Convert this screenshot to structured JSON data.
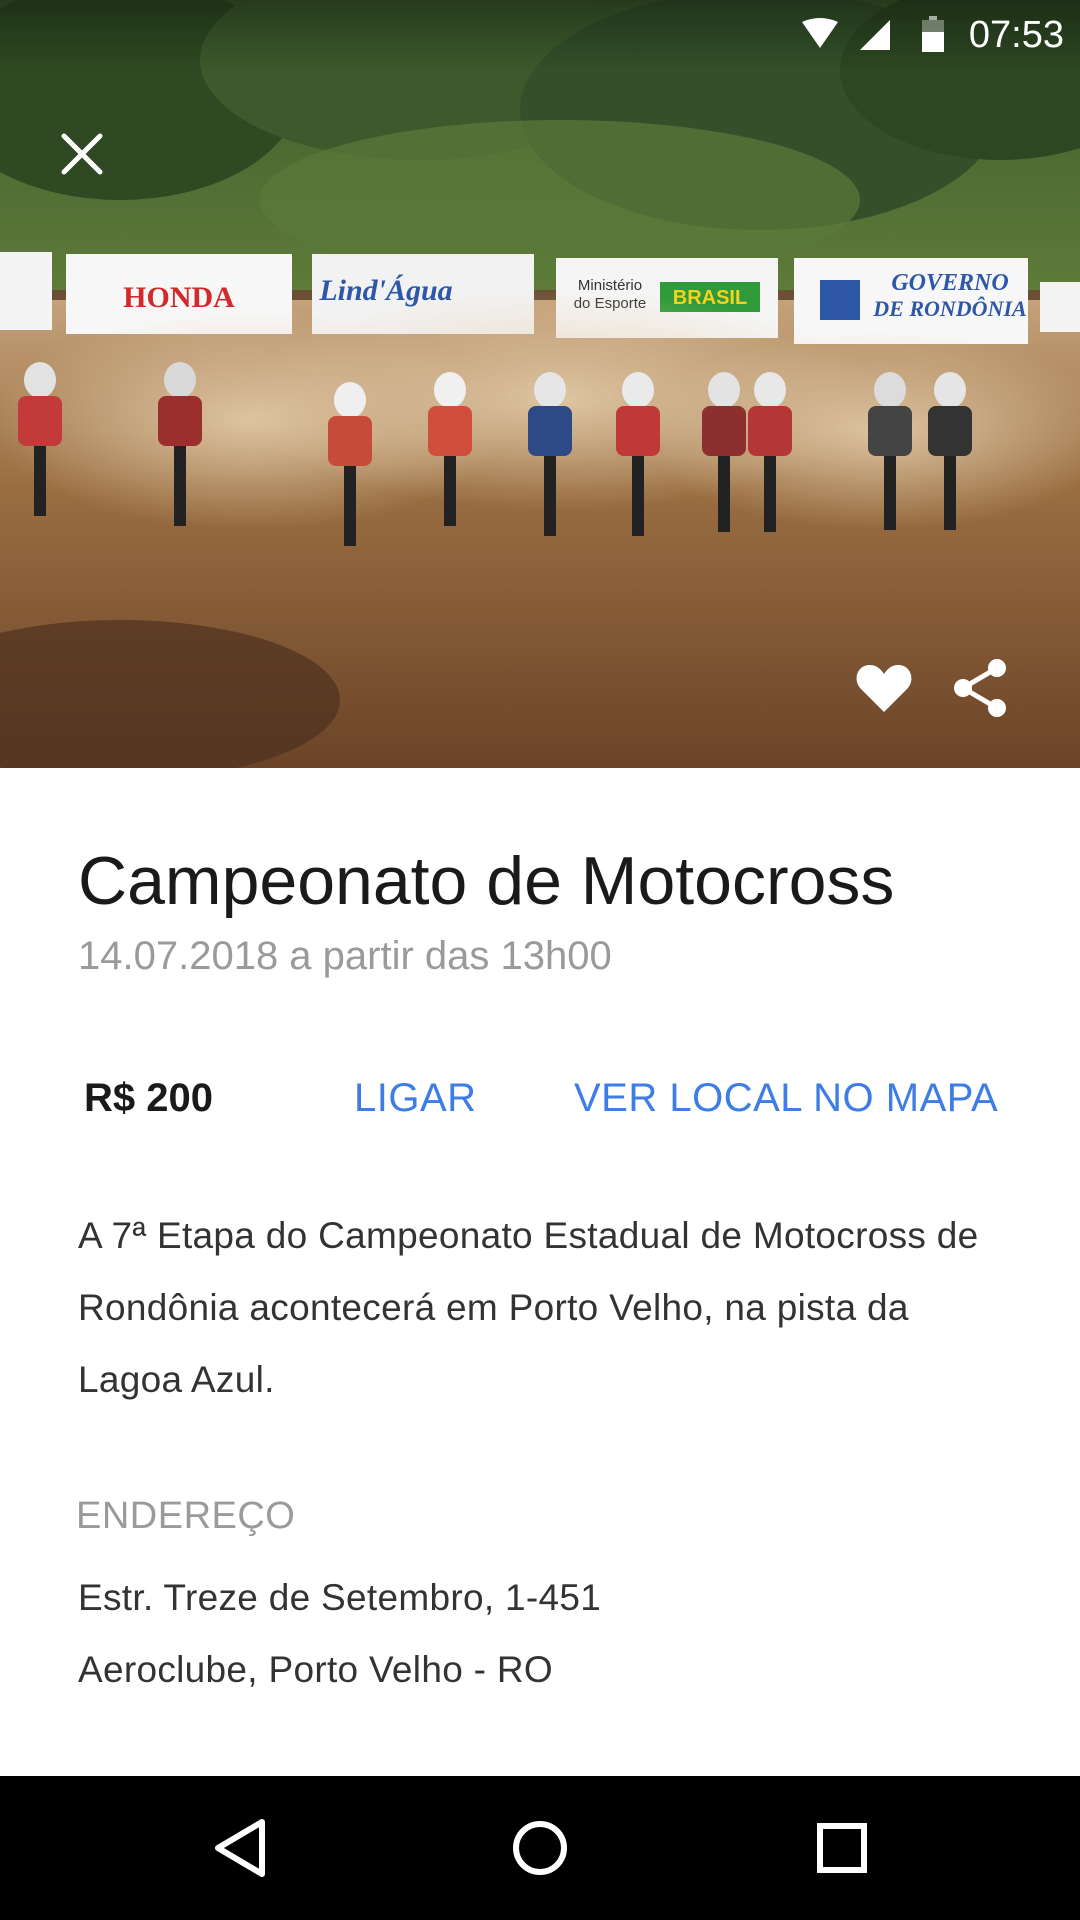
{
  "status_bar": {
    "time": "07:53",
    "icons": [
      "wifi-icon",
      "cell-signal-icon",
      "battery-icon"
    ]
  },
  "hero": {
    "description_icon": "event-photo",
    "banners": [
      "HONDA",
      "Lind'Água",
      "Ministério do Esporte",
      "BRASIL",
      "GOVERNO DE RONDÔNIA"
    ],
    "close_icon": "close-icon",
    "favorite_icon": "heart-icon",
    "share_icon": "share-icon"
  },
  "event": {
    "title": "Campeonato de Motocross",
    "date_time": "14.07.2018 a partir das 13h00",
    "price": "R$ 200",
    "call_label": "LIGAR",
    "map_label": "VER LOCAL NO MAPA",
    "description": "A 7ª Etapa do Campeonato Estadual de Motocross de Rondônia acontecerá em Porto Velho, na pista da Lagoa Azul.",
    "address_label": "ENDEREÇO",
    "address_line1": "Estr. Treze de Setembro, 1-451",
    "address_line2": "Aeroclube, Porto Velho - RO"
  },
  "nav_bar": {
    "icons": [
      "back-icon",
      "home-icon",
      "recents-icon"
    ]
  },
  "colors": {
    "accent": "#3d7de5",
    "text_primary": "#1a1a1a",
    "text_secondary": "#9a9a9a",
    "nav_background": "#000000"
  }
}
